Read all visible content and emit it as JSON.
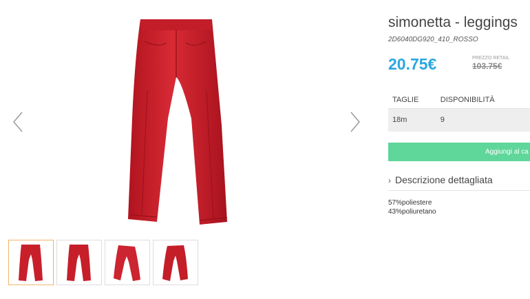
{
  "product": {
    "title": "simonetta - leggings",
    "sku": "2D6040DG920_410_ROSSO",
    "price": "20.75€",
    "retail_label": "PREZZO RETAIL",
    "retail_price": "103.75€"
  },
  "sizes": {
    "headers": [
      "TAGLIE",
      "DISPONIBILITÀ"
    ],
    "rows": [
      {
        "size": "18m",
        "availability": "9"
      }
    ]
  },
  "actions": {
    "add_to_cart": "Aggiungi al ca"
  },
  "description": {
    "toggle_label": "Descrizione dettagliata",
    "lines": [
      "57%poliestere",
      "43%poliuretano"
    ]
  },
  "gallery": {
    "main_icon": "leggings-image",
    "prev_icon": "chevron-left-icon",
    "next_icon": "chevron-right-icon",
    "thumbnail_count": 4,
    "active_thumbnail": 1
  },
  "colors": {
    "price": "#2aa7e0",
    "button": "#5fd69a",
    "product_red": "#d0202c",
    "thumb_active_border": "#f0b46a"
  }
}
